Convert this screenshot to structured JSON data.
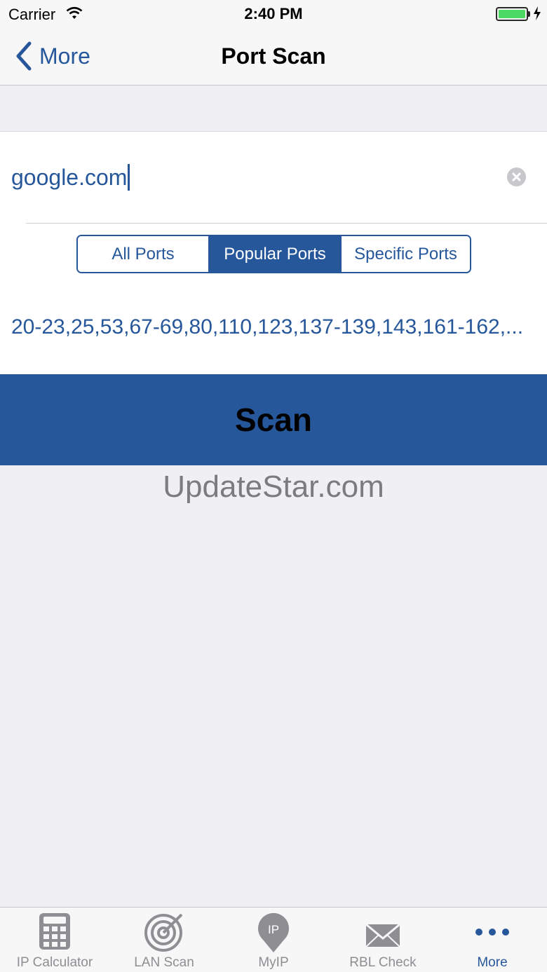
{
  "status": {
    "carrier": "Carrier",
    "time": "2:40 PM"
  },
  "nav": {
    "back_label": "More",
    "title": "Port Scan"
  },
  "form": {
    "host_value": "google.com",
    "segments": [
      "All Ports",
      "Popular Ports",
      "Specific Ports"
    ],
    "selected_segment": "Popular Ports",
    "ports_text": "20-23,25,53,67-69,80,110,123,137-139,143,161-162,..."
  },
  "scan_button_label": "Scan",
  "watermark": "UpdateStar.com",
  "tabs": [
    {
      "label": "IP Calculator",
      "icon": "calculator-icon"
    },
    {
      "label": "LAN Scan",
      "icon": "radar-icon"
    },
    {
      "label": "MyIP",
      "icon": "ip-pin-icon"
    },
    {
      "label": "RBL Check",
      "icon": "envelope-icon"
    },
    {
      "label": "More",
      "icon": "more-dots-icon",
      "active": true
    }
  ],
  "colors": {
    "accent": "#27579b",
    "scan_button": "#26579a",
    "battery": "#4cd964",
    "background": "#efeff4"
  }
}
